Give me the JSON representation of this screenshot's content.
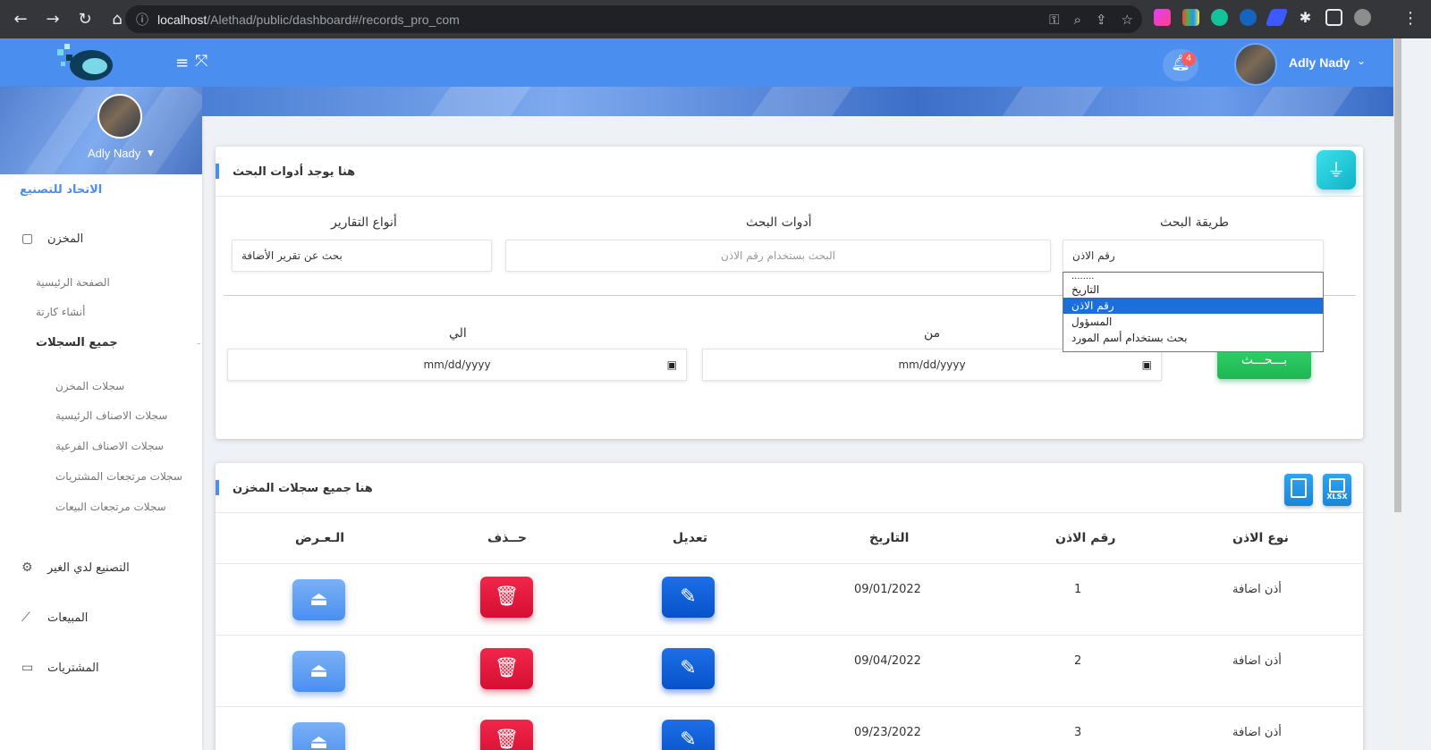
{
  "browser": {
    "url_host": "localhost",
    "url_path": "/Alethad/public/dashboard#/records_pro_com"
  },
  "header": {
    "notification_count": "4",
    "user_name": "Adly Nady"
  },
  "sidebar": {
    "user_name": "Adly Nady",
    "brand": "الاتحاد للتصنيع",
    "sections": [
      {
        "label": "المخزن"
      },
      {
        "label": "التصنيع لدي الغير"
      },
      {
        "label": "المبيعات"
      },
      {
        "label": "المشتريات"
      }
    ],
    "sub_items": [
      {
        "label": "الصفحة الرئيسية"
      },
      {
        "label": "أنشاء كارتة"
      },
      {
        "label": "جميع السجلات"
      }
    ],
    "records_items": [
      {
        "label": "سجلات المخزن"
      },
      {
        "label": "سجلات الاصناف الرئيسية"
      },
      {
        "label": "سجلات الاصناف الفرعية"
      },
      {
        "label": "سجلات مرتجعات المشتريات"
      },
      {
        "label": "سجلات مرتجعات البيعات"
      }
    ]
  },
  "search_card": {
    "title": "هنا يوجد أدوات البحث",
    "method_label": "طريقة البحث",
    "method_value": "رقم الاذن",
    "tools_label": "أدوات البحث",
    "tools_placeholder": "البحث بستخدام رقم الاذن",
    "reports_label": "أنواع التقارير",
    "reports_value": "بحث عن تقرير الأضافة",
    "dropdown_options": [
      "........",
      "التاريخ",
      "رقم الاذن",
      "المسؤول",
      "بحث بستخدام أسم المورد"
    ],
    "dropdown_selected": "رقم الاذن",
    "from_label": "من",
    "to_label": "الي",
    "date_placeholder": "mm/dd/yyyy",
    "search_button": "بـــحـــث"
  },
  "records_card": {
    "title": "هنا جميع سجلات المخزن",
    "xlsx_label": "XLSX",
    "columns": {
      "type": "نوع الاذن",
      "number": "رقم الاذن",
      "date": "التاريخ",
      "edit": "تعديل",
      "delete": "حــذف",
      "view": "الـعـرض"
    },
    "rows": [
      {
        "type": "أذن اضافة",
        "number": "1",
        "date": "09/01/2022"
      },
      {
        "type": "أذن اضافة",
        "number": "2",
        "date": "09/04/2022"
      },
      {
        "type": "أذن اضافة",
        "number": "3",
        "date": "09/23/2022"
      }
    ]
  },
  "colors": {
    "header_blue": "#4a8ff0",
    "accent_cyan": "#10b3c7",
    "delete_red": "#d70e33",
    "edit_blue": "#0752c9",
    "search_green": "#1fb653"
  }
}
